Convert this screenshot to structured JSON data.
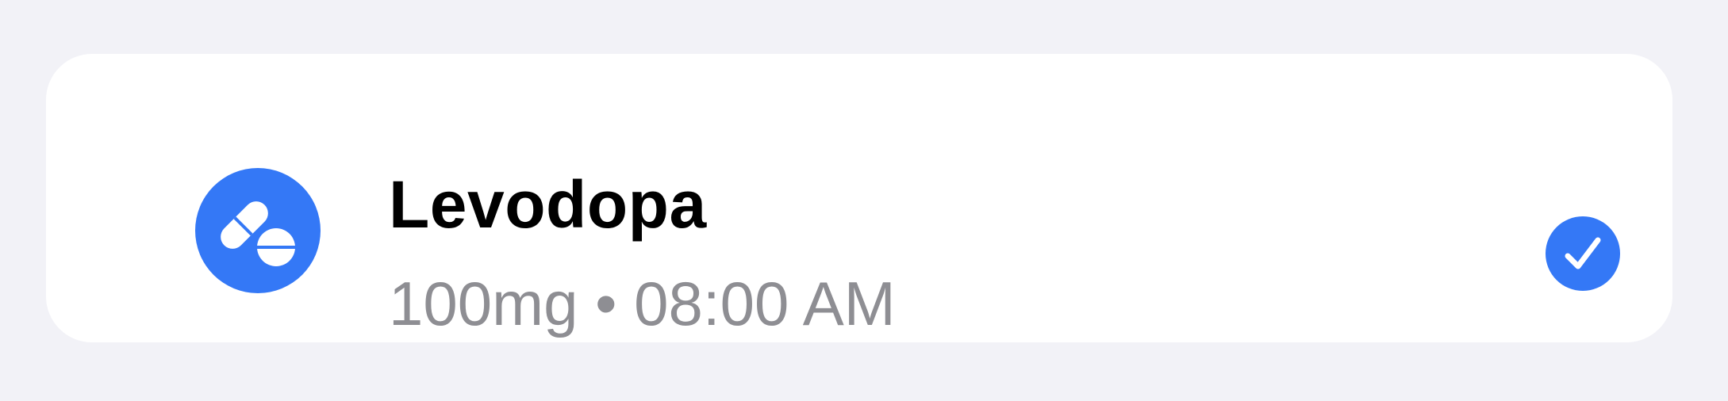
{
  "medication": {
    "name": "Levodopa",
    "detail": "100mg • 08:00 AM",
    "icon": "pills-icon",
    "status_icon": "checkmark-circle-icon",
    "taken": true
  },
  "colors": {
    "accent": "#3478F6",
    "background": "#F2F2F7",
    "card": "#FFFFFF",
    "title": "#000000",
    "subtitle": "#8E8E93"
  }
}
